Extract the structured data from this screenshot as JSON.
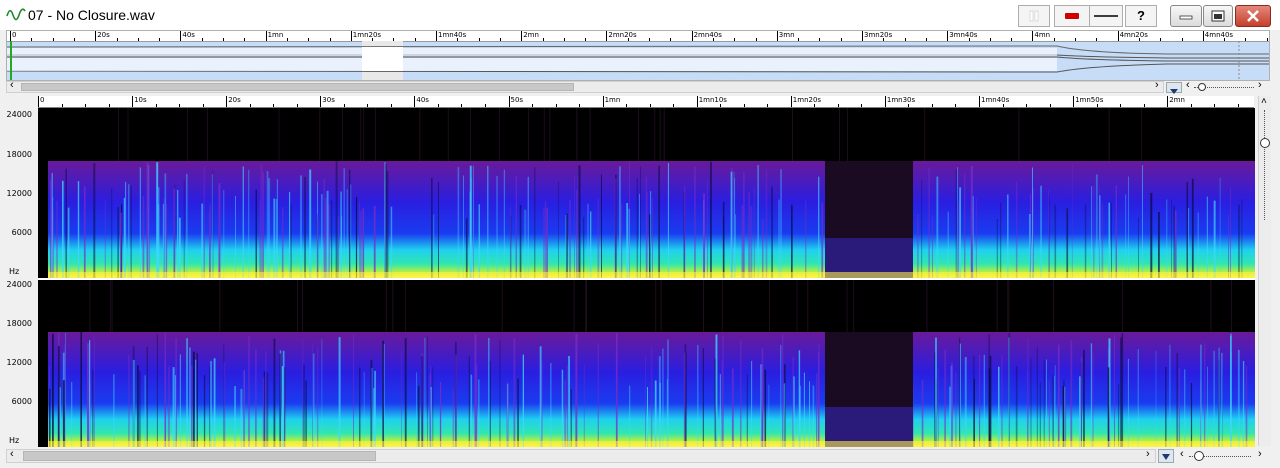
{
  "window": {
    "title": "07 - No Closure.wav",
    "buttons": {
      "record_icon": "record-icon",
      "line_icon": "line-icon",
      "help_label": "?"
    }
  },
  "overview": {
    "ticks": [
      "0",
      "20s",
      "40s",
      "1mn",
      "1mn20s",
      "1mn40s",
      "2mn",
      "2mn20s",
      "2mn40s",
      "3mn",
      "3mn20s",
      "3mn40s",
      "4mn",
      "4mn20s",
      "4mn40s"
    ]
  },
  "main": {
    "ticks": [
      "0",
      "10s",
      "20s",
      "30s",
      "40s",
      "50s",
      "1mn",
      "1mn10s",
      "1mn20s",
      "1mn30s",
      "1mn40s",
      "1mn50s",
      "2mn"
    ],
    "y_labels": [
      "24000",
      "18000",
      "12000",
      "6000"
    ],
    "y_unit": "Hz"
  },
  "colors": {
    "spectrum_low": "#ffff3a",
    "spectrum_mid": "#1fd0f0",
    "spectrum_high": "#2a1ee0",
    "spectrum_top": "#6a1a9a",
    "background": "#000000",
    "overview_bg": "#c7dcf7"
  }
}
